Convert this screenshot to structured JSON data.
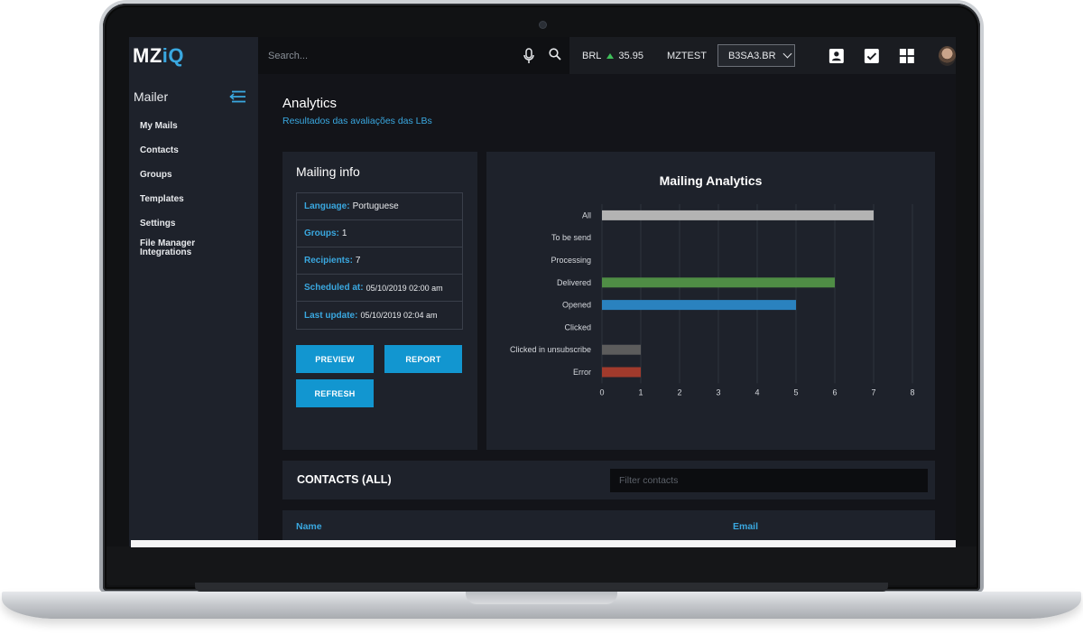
{
  "topbar": {
    "logo_main": "MZ",
    "logo_accent": "iQ",
    "search_placeholder": "Search...",
    "currency": "BRL",
    "currency_value": "35.95",
    "company": "MZTEST",
    "ticker_select": "B3SA3.BR",
    "trend_color": "#3fbf5a"
  },
  "sidebar": {
    "title": "Mailer",
    "items": [
      {
        "label": "My Mails"
      },
      {
        "label": "Contacts"
      },
      {
        "label": "Groups"
      },
      {
        "label": "Templates"
      },
      {
        "label": "Settings"
      },
      {
        "label": "File Manager"
      },
      {
        "label": "Integrations"
      }
    ]
  },
  "page": {
    "title": "Analytics",
    "subtitle": "Resultados das avaliações das LBs"
  },
  "mailing_info": {
    "title": "Mailing info",
    "rows": [
      {
        "key": "Language:",
        "value": "Portuguese"
      },
      {
        "key": "Groups:",
        "value": "1"
      },
      {
        "key": "Recipients:",
        "value": "7"
      },
      {
        "key": "Scheduled at:",
        "value": "05/10/2019 02:00 am"
      },
      {
        "key": "Last update:",
        "value": "05/10/2019 02:04 am"
      }
    ],
    "buttons": {
      "preview": "PREVIEW",
      "report": "REPORT",
      "refresh": "REFRESH"
    }
  },
  "chart_data": {
    "type": "bar",
    "orientation": "horizontal",
    "title": "Mailing Analytics",
    "categories": [
      "All",
      "To be send",
      "Processing",
      "Delivered",
      "Opened",
      "Clicked",
      "Clicked in unsubscribe",
      "Error"
    ],
    "values": [
      7,
      0,
      0,
      6,
      5,
      0,
      1,
      1
    ],
    "colors": [
      "#b3b3b3",
      "#b3b3b3",
      "#b3b3b3",
      "#4f8d45",
      "#2a82bf",
      "#b3b3b3",
      "#5c5c5c",
      "#a13a2c"
    ],
    "xlim": [
      0,
      8
    ],
    "xticks": [
      "0",
      "1",
      "2",
      "3",
      "4",
      "5",
      "6",
      "7",
      "8"
    ],
    "grid": true
  },
  "contacts": {
    "title": "CONTACTS (ALL)",
    "filter_placeholder": "Filter contacts",
    "columns": [
      "Name",
      "Email"
    ]
  }
}
